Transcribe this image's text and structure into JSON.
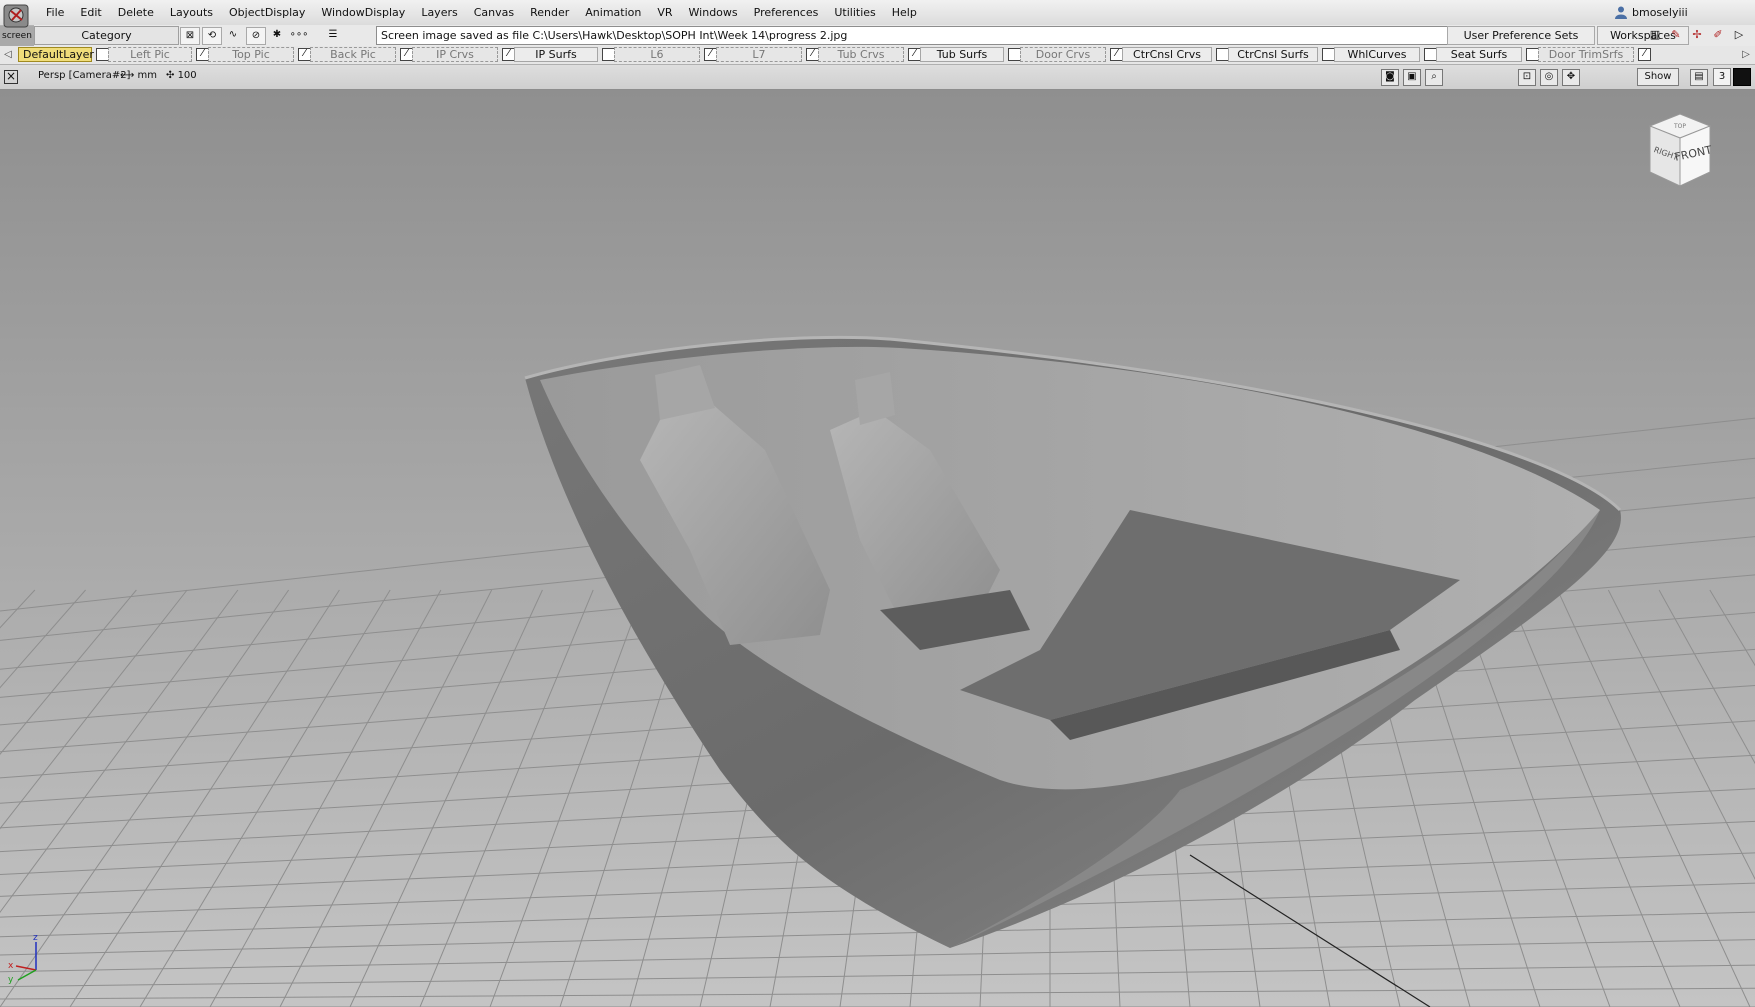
{
  "app": {
    "logo_label": "screen",
    "menus": [
      "File",
      "Edit",
      "Delete",
      "Layouts",
      "ObjectDisplay",
      "WindowDisplay",
      "Layers",
      "Canvas",
      "Render",
      "Animation",
      "VR",
      "Windows",
      "Preferences",
      "Utilities",
      "Help"
    ],
    "user_name": "bmoselyiii"
  },
  "toolbar": {
    "category_label": "Category",
    "status_message": "Screen image saved as file C:\\Users\\Hawk\\Desktop\\SOPH Int\\Week 14\\progress 2.jpg",
    "user_preference_sets": "User Preference Sets",
    "workspaces": "Workspaces"
  },
  "layers": [
    {
      "name": "DefaultLayer",
      "state": "active"
    },
    {
      "name": "Left Pic",
      "state": "selected-dashed"
    },
    {
      "name": "Top Pic",
      "state": "dashed"
    },
    {
      "name": "Back Pic",
      "state": "dashed"
    },
    {
      "name": "IP Crvs",
      "state": "dashed"
    },
    {
      "name": "IP Surfs",
      "state": "normal"
    },
    {
      "name": "L6",
      "state": "dashed"
    },
    {
      "name": "L7",
      "state": "dashed"
    },
    {
      "name": "Tub Crvs",
      "state": "dashed"
    },
    {
      "name": "Tub Surfs",
      "state": "normal"
    },
    {
      "name": "Door Crvs",
      "state": "dashed"
    },
    {
      "name": "CtrCnsl Crvs",
      "state": "normal"
    },
    {
      "name": "CtrCnsl Surfs",
      "state": "normal"
    },
    {
      "name": "WhlCurves",
      "state": "normal"
    },
    {
      "name": "Seat Surfs",
      "state": "normal"
    },
    {
      "name": "Door TrimSrfs",
      "state": "dashed"
    }
  ],
  "viewport": {
    "camera_label": "Persp [Camera#2]",
    "units_label": "mm",
    "grid_label": "100",
    "show_button": "Show",
    "viewport_number": "3",
    "viewcube": {
      "front": "FRONT",
      "right": "RIGHT",
      "top": "TOP"
    },
    "axes": {
      "x": "x",
      "y": "y",
      "z": "z"
    },
    "colors": {
      "background_top": "#8f8f8f",
      "background_bottom": "#c4c4c4",
      "model": "#7d7d7d"
    }
  },
  "icons": [
    "app-logo-icon",
    "user-icon",
    "pick-icon",
    "curve-icon",
    "construct-icon",
    "snap-icon",
    "dots-icon",
    "list-icon",
    "viewcube-icon",
    "axis-triad-icon"
  ]
}
